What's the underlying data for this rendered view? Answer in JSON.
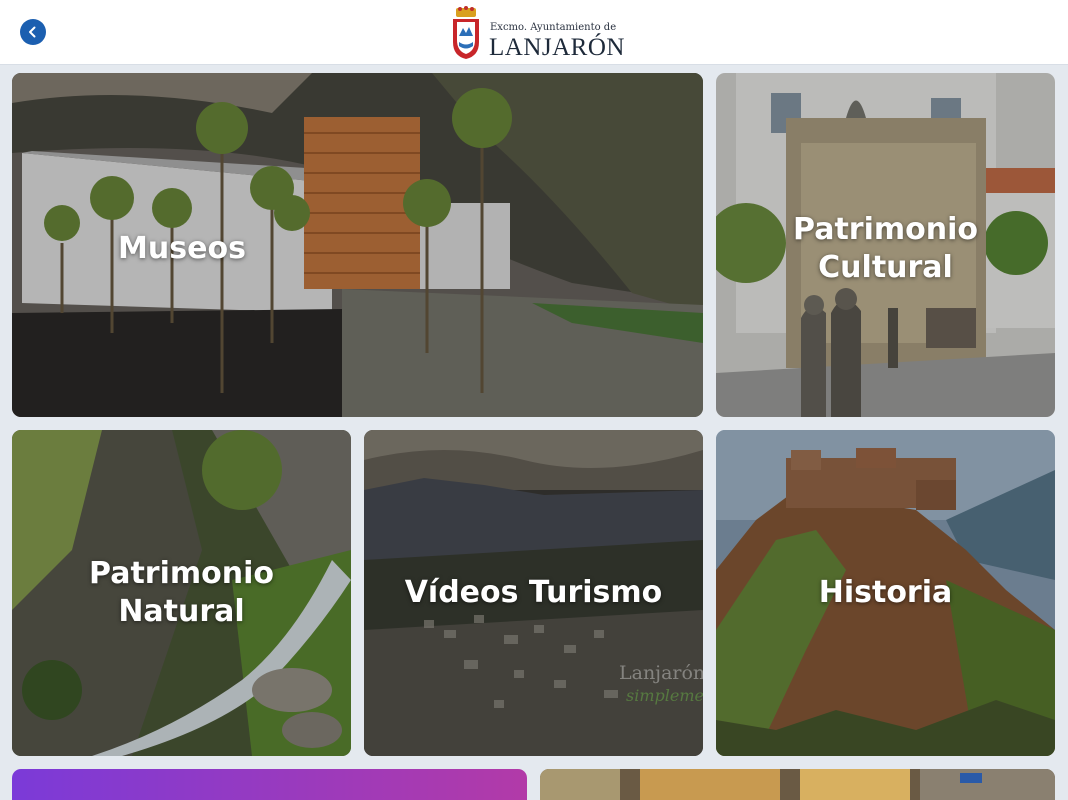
{
  "header": {
    "back_icon": "chevron-left-icon",
    "logo_top": "Excmo. Ayuntamiento de",
    "logo_main": "LANJARÓN"
  },
  "tiles": [
    {
      "label": "Museos"
    },
    {
      "label": "Patrimonio\nCultural"
    },
    {
      "label": "Patrimonio\nNatural"
    },
    {
      "label": "Vídeos Turismo"
    },
    {
      "label": "Historia"
    }
  ],
  "videos_watermark": {
    "line1": "Lanjarón",
    "line2": "simplemente"
  },
  "colors": {
    "accent": "#1b5fb0",
    "background": "#e4e9ef",
    "purple_start": "#7b3ad8",
    "purple_end": "#b23aa8"
  }
}
